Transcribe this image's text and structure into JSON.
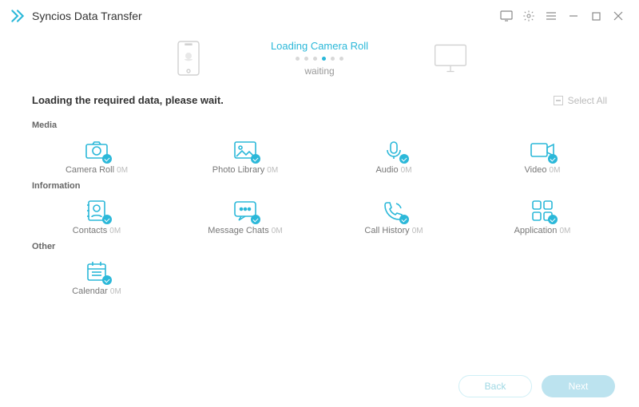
{
  "app": {
    "title": "Syncios Data Transfer"
  },
  "header": {
    "loading_label": "Loading Camera Roll",
    "waiting_label": "waiting",
    "active_step": 3,
    "total_steps": 6
  },
  "status": {
    "message": "Loading the required data, please wait.",
    "select_all": "Select All"
  },
  "sections": {
    "media": {
      "label": "Media",
      "items": [
        {
          "name": "Camera Roll",
          "size": "0M"
        },
        {
          "name": "Photo Library",
          "size": "0M"
        },
        {
          "name": "Audio",
          "size": "0M"
        },
        {
          "name": "Video",
          "size": "0M"
        }
      ]
    },
    "information": {
      "label": "Information",
      "items": [
        {
          "name": "Contacts",
          "size": "0M"
        },
        {
          "name": "Message Chats",
          "size": "0M"
        },
        {
          "name": "Call History",
          "size": "0M"
        },
        {
          "name": "Application",
          "size": "0M"
        }
      ]
    },
    "other": {
      "label": "Other",
      "items": [
        {
          "name": "Calendar",
          "size": "0M"
        }
      ]
    }
  },
  "footer": {
    "back": "Back",
    "next": "Next"
  }
}
